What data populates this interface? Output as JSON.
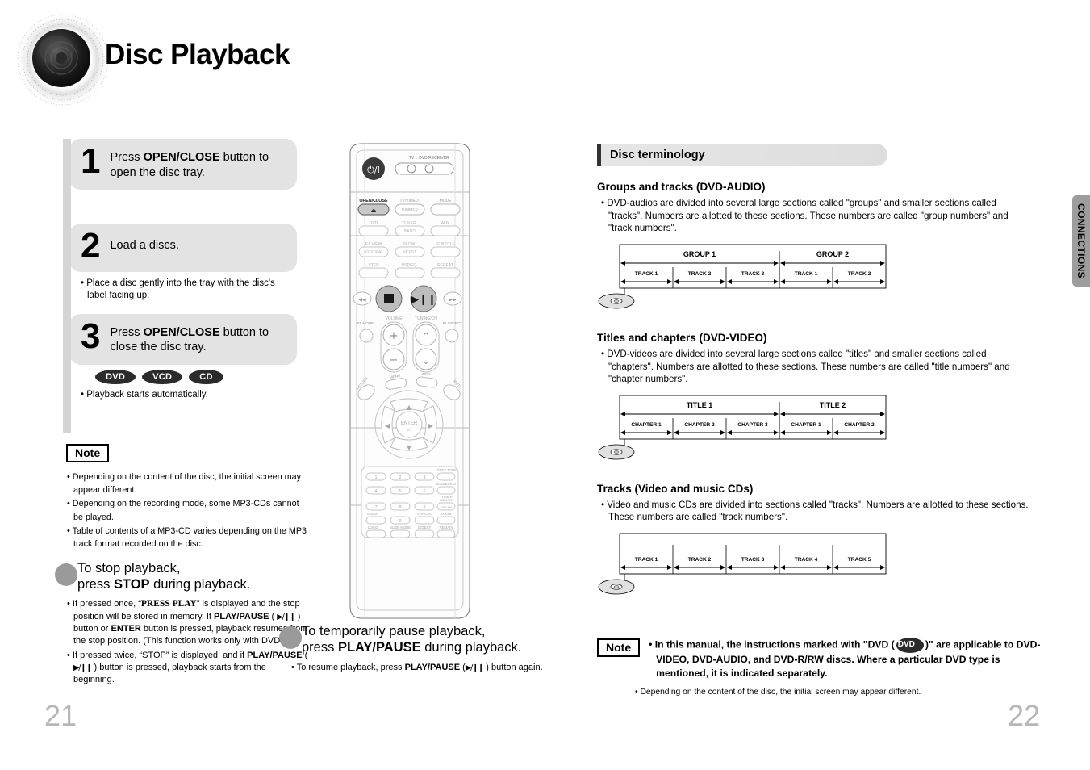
{
  "header": {
    "title": "Disc Playback",
    "logo_icon": "disc-logo-icon"
  },
  "steps": [
    {
      "number": "1",
      "text_pre": "Press ",
      "text_bold": "OPEN/CLOSE",
      "text_post": " button to open the disc tray.",
      "substeps": [],
      "badges": []
    },
    {
      "number": "2",
      "text_pre": "Load a discs.",
      "text_bold": "",
      "text_post": "",
      "substeps": [
        "• Place a disc gently into the tray with the disc's label facing up."
      ],
      "badges": []
    },
    {
      "number": "3",
      "text_pre": "Press ",
      "text_bold": "OPEN/CLOSE",
      "text_post": " button to close the disc tray.",
      "substeps": [
        "• Playback starts automatically."
      ],
      "badges": [
        "DVD",
        "VCD",
        "CD"
      ]
    }
  ],
  "left_note": {
    "label": "Note",
    "lines": [
      "• Depending on the content of the disc, the initial screen may appear different.",
      "• Depending on the recording mode, some MP3-CDs cannot be played.",
      "• Table of contents of a MP3-CD varies depending on the MP3 track format recorded on the disc."
    ]
  },
  "stop_section": {
    "heading_line1": "To stop playback,",
    "heading_line2_pre": "press ",
    "heading_line2_bold": "STOP",
    "heading_line2_post": " during playback.",
    "bullets": [
      {
        "parts": [
          {
            "t": "• If pressed once, “",
            "s": "n"
          },
          {
            "t": "PRESS PLAY",
            "s": "sc"
          },
          {
            "t": "” is displayed and the stop position will be stored in memory. If ",
            "s": "n"
          },
          {
            "t": "PLAY/PAUSE",
            "s": "b"
          },
          {
            "t": " ( ",
            "s": "n"
          },
          {
            "t": "▶/❙❙",
            "s": "g"
          },
          {
            "t": " ) button or ",
            "s": "n"
          },
          {
            "t": "ENTER",
            "s": "b"
          },
          {
            "t": " button is pressed, playback resumes from the stop position. (This function works only with DVDs.)",
            "s": "n"
          }
        ]
      },
      {
        "parts": [
          {
            "t": "• If pressed twice, “STOP” is displayed, and if ",
            "s": "n"
          },
          {
            "t": "PLAY/PAUSE",
            "s": "b"
          },
          {
            "t": " ( ",
            "s": "n"
          },
          {
            "t": "▶/❙❙",
            "s": "g"
          },
          {
            "t": " ) button is pressed, playback starts from the beginning.",
            "s": "n"
          }
        ]
      }
    ]
  },
  "pause_section": {
    "heading_line1": "To temporarily pause playback,",
    "heading_line2_pre": "press ",
    "heading_line2_bold": "PLAY/PAUSE",
    "heading_line2_post": " during playback.",
    "bullets": [
      {
        "parts": [
          {
            "t": "• To resume playback, press ",
            "s": "n"
          },
          {
            "t": "PLAY/PAUSE",
            "s": "b"
          },
          {
            "t": " (",
            "s": "n"
          },
          {
            "t": "▶/❙❙",
            "s": "g"
          },
          {
            "t": " ) button again.",
            "s": "n"
          }
        ]
      }
    ]
  },
  "remote": {
    "top_labels": {
      "tv": "TV",
      "dvd_receiver": "DVD RECEIVER",
      "open_close": "OPEN/CLOSE",
      "tv_video": "TV/VIDEO",
      "dimmer": "DIMMER",
      "mode": "MODE",
      "dvd": "DVD",
      "tuner": "TUNER",
      "band": "BAND",
      "aux": "AUX",
      "ez_view": "EZ VIEW",
      "ntsc_pal": "NTSC/PAL",
      "slow": "SLOW",
      "mo_st": "MO/ST",
      "subtitle": "SUBTITLE",
      "step": "STEP",
      "dsp_eq": "DSP/EQ",
      "repeat": "REPEAT",
      "volume": "VOLUME",
      "tuning_ch": "TUNING/CH",
      "fl_mode": "FL MODE",
      "fl_effect": "FL EFFECT",
      "menu": "MENU",
      "info": "INFO",
      "return": "RETURN",
      "mute": "MUTE",
      "enter": "ENTER"
    },
    "keypad": [
      "1",
      "2",
      "3",
      "4",
      "5",
      "6",
      "7",
      "8",
      "9",
      "0"
    ],
    "keypad_labels": {
      "test_tone": "TEST TONE",
      "sound_edit": "SOUND EDIT",
      "tuner_memory": "TUNER MEMORY",
      "p_scan": "P.SCAN",
      "sleep": "SLEEP",
      "cancel": "CANCEL",
      "zoom": "ZOOM",
      "logo": "LOGO",
      "slide_mode": "SLIDE MODE",
      "digest": "DIGEST",
      "remain": "REMAIN"
    }
  },
  "disc_terminology": {
    "header": "Disc terminology",
    "sections": [
      {
        "title": "Groups and tracks (DVD-AUDIO)",
        "body": "• DVD-audios are divided into several large sections called \"groups\" and smaller sections called \"tracks\". Numbers are allotted to these sections. These numbers are called \"group numbers\" and \"track numbers\".",
        "diagram": {
          "top_row": [
            {
              "label": "GROUP 1",
              "span": 3
            },
            {
              "label": "GROUP 2",
              "span": 2
            }
          ],
          "bottom_row": [
            "TRACK 1",
            "TRACK 2",
            "TRACK 3",
            "TRACK 1",
            "TRACK 2"
          ]
        }
      },
      {
        "title": "Titles and chapters (DVD-VIDEO)",
        "body": "• DVD-videos are divided into several large sections called \"titles\" and smaller sections called \"chapters\". Numbers are allotted to these sections. These numbers are called \"title numbers\" and \"chapter numbers\".",
        "diagram": {
          "top_row": [
            {
              "label": "TITLE 1",
              "span": 3
            },
            {
              "label": "TITLE 2",
              "span": 2
            }
          ],
          "bottom_row": [
            "CHAPTER 1",
            "CHAPTER 2",
            "CHAPTER 3",
            "CHAPTER 1",
            "CHAPTER 2"
          ]
        }
      },
      {
        "title": "Tracks (Video and music CDs)",
        "body": "• Video and music CDs are divided into sections called \"tracks\". Numbers are allotted to these sections. These numbers are called \"track numbers\".",
        "diagram": {
          "top_row": [],
          "bottom_row": [
            "TRACK 1",
            "TRACK 2",
            "TRACK 3",
            "TRACK 4",
            "TRACK 5"
          ]
        }
      }
    ]
  },
  "right_note": {
    "label": "Note",
    "bold_pre": "• In this manual, the instructions marked with \"DVD (",
    "badge": "DVD",
    "bold_post": ")\" are applicable to DVD-VIDEO, DVD-AUDIO, and DVD-R/RW discs. Where a particular DVD type is mentioned, it is indicated separately.",
    "small": "• Depending on the content of the disc, the initial screen may appear different."
  },
  "side_tab": {
    "label": "CONNECTIONS"
  },
  "pages": {
    "left": "21",
    "right": "22"
  },
  "colors": {
    "step_box_bg": "#e3e3e3",
    "badge_bg": "#2b2b2b",
    "side_tab_bg": "#9d9d9d",
    "page_num": "#b7b7b7"
  }
}
